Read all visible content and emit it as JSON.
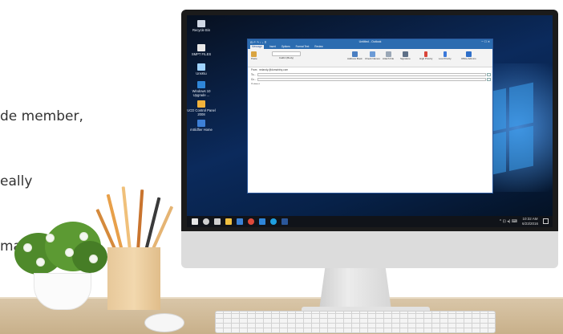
{
  "side_text": {
    "lines": [
      "de member,",
      "eally",
      "mail body is"
    ]
  },
  "desktop": {
    "icons": [
      {
        "label": "Recycle Bin",
        "icon": "recycle-bin-icon",
        "color": "#cfd8e6"
      },
      {
        "label": "SMPT FILES",
        "icon": "file-icon",
        "color": "#e8e8e8"
      },
      {
        "label": "UnsKiu",
        "icon": "app-icon",
        "color": "#9fd3ff"
      },
      {
        "label": "Windows 10 Upgrade ...",
        "icon": "windows-upgrade-icon",
        "color": "#2f86d8"
      },
      {
        "label": "UCD Control Panel 2008",
        "icon": "control-panel-icon",
        "color": "#f2b23b"
      },
      {
        "label": "mSldfier Home",
        "icon": "app-icon-2",
        "color": "#3d7fd6"
      }
    ],
    "taskbar": {
      "icons": [
        {
          "name": "start-icon",
          "color": "#e6e6e6"
        },
        {
          "name": "search-icon",
          "color": "#cfcfcf"
        },
        {
          "name": "task-view-icon",
          "color": "#cfcfcf"
        },
        {
          "name": "file-explorer-icon",
          "color": "#f0c040"
        },
        {
          "name": "store-icon",
          "color": "#3b82d6"
        },
        {
          "name": "chrome-icon",
          "color": "#e04a3a"
        },
        {
          "name": "mail-icon",
          "color": "#2f86d8"
        },
        {
          "name": "skype-icon",
          "color": "#1fa0e0"
        },
        {
          "name": "outlook-icon",
          "color": "#2b579a"
        }
      ],
      "time": "10:32 AM",
      "date": "6/23/2016",
      "tray": "^ ⊡ ◂) ⌨"
    }
  },
  "outlook": {
    "window_title": "Untitled - Outlook",
    "quick_access": "⊟ ↶ ↷ ↑ ↓ ⊽",
    "window_controls": "─ ☐ ✕",
    "tabs": [
      {
        "label": "Message",
        "active": true
      },
      {
        "label": "Insert",
        "active": false
      },
      {
        "label": "Options",
        "active": false
      },
      {
        "label": "Format Text",
        "active": false
      },
      {
        "label": "Review",
        "active": false
      }
    ],
    "ribbon": [
      {
        "label": "Paste",
        "icon": "paste-icon"
      },
      {
        "label": "Calibri (Body)",
        "icon": "font-icon"
      },
      {
        "label": "Address Book",
        "icon": "address-book-icon"
      },
      {
        "label": "Check Names",
        "icon": "check-names-icon"
      },
      {
        "label": "Attach File",
        "icon": "attach-icon"
      },
      {
        "label": "Signature",
        "icon": "signature-icon"
      },
      {
        "label": "High Priority",
        "icon": "priority-icon"
      },
      {
        "label": "Low Priority",
        "icon": "low-priority-icon"
      },
      {
        "label": "Office Add-ins",
        "icon": "addins-icon"
      }
    ],
    "fields": {
      "from_label": "From",
      "from_value": "mrlandy.@domainhq.com",
      "to_label": "To...",
      "cc_label": "Cc...",
      "subject_label": "Subject"
    }
  }
}
